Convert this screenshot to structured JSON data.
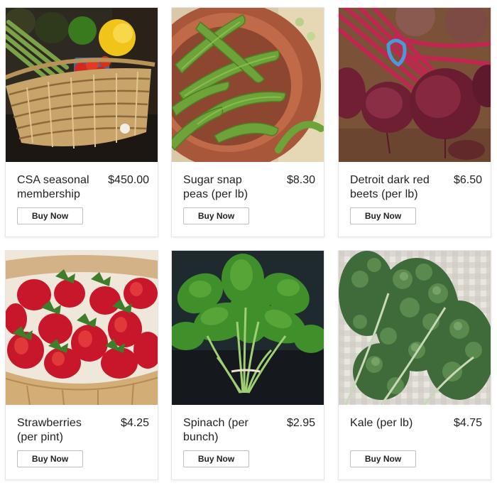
{
  "products": [
    {
      "name": "CSA seasonal membership",
      "price": "$450.00",
      "button": "Buy Now",
      "photo": "basket-of-vegetables"
    },
    {
      "name": "Sugar snap peas (per lb)",
      "price": "$8.30",
      "button": "Buy Now",
      "photo": "sugar-snap-peas"
    },
    {
      "name": "Detroit dark red beets (per lb)",
      "price": "$6.50",
      "button": "Buy Now",
      "photo": "red-beets"
    },
    {
      "name": "Strawberries (per pint)",
      "price": "$4.25",
      "button": "Buy Now",
      "photo": "strawberries"
    },
    {
      "name": "Spinach (per bunch)",
      "price": "$2.95",
      "button": "Buy Now",
      "photo": "spinach"
    },
    {
      "name": "Kale (per lb)",
      "price": "$4.75",
      "button": "Buy Now",
      "photo": "kale"
    }
  ]
}
